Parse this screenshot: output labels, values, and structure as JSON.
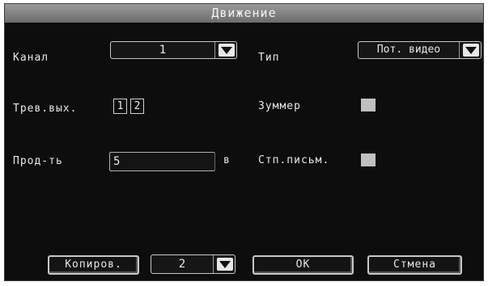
{
  "dialog": {
    "title": "Движение"
  },
  "fields": {
    "channel_label": "Канал",
    "channel_value": "1",
    "type_label": "Тип",
    "type_value": "Пот. видео",
    "alarm_out_label": "Трев.вых.",
    "alarm_out_1": "1",
    "alarm_out_2": "2",
    "buzzer_label": "Зуммер",
    "duration_label": "Прод-ть",
    "duration_value": "5",
    "duration_unit": "в",
    "email_label": "Стп.письм."
  },
  "footer": {
    "copy_label": "Копиров.",
    "copy_target_value": "2",
    "ok_label": "ОК",
    "cancel_label": "Стмена"
  },
  "colors": {
    "background": "#0d0d0d",
    "titlebar": "#7c7c7c",
    "text": "#e8e8e8",
    "checkbox": "#c0c0c0"
  }
}
